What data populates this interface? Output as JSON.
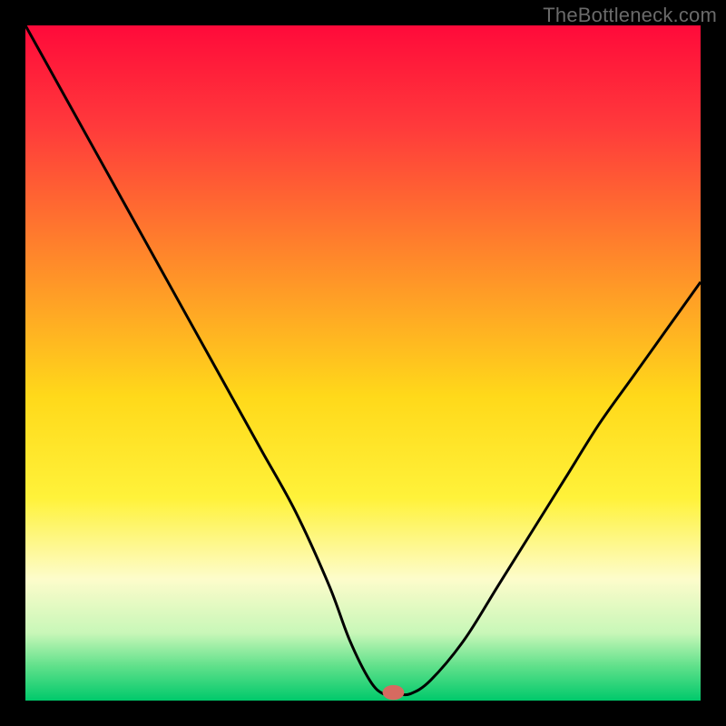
{
  "watermark": "TheBottleneck.com",
  "chart_data": {
    "type": "line",
    "title": "",
    "xlabel": "",
    "ylabel": "",
    "xlim": [
      0,
      100
    ],
    "ylim": [
      0,
      100
    ],
    "background_gradient": {
      "stops": [
        {
          "offset": 0.0,
          "color": "#ff0a3a"
        },
        {
          "offset": 0.15,
          "color": "#ff3a3b"
        },
        {
          "offset": 0.35,
          "color": "#ff8a2a"
        },
        {
          "offset": 0.55,
          "color": "#ffd91a"
        },
        {
          "offset": 0.7,
          "color": "#fff23a"
        },
        {
          "offset": 0.82,
          "color": "#fdfccb"
        },
        {
          "offset": 0.9,
          "color": "#c8f7b8"
        },
        {
          "offset": 0.95,
          "color": "#5ee08a"
        },
        {
          "offset": 1.0,
          "color": "#00c96b"
        }
      ]
    },
    "series": [
      {
        "name": "bottleneck-curve",
        "color": "#000000",
        "x": [
          0,
          5,
          10,
          15,
          20,
          25,
          30,
          35,
          40,
          45,
          48,
          51,
          53,
          55,
          57,
          60,
          65,
          70,
          75,
          80,
          85,
          90,
          95,
          100
        ],
        "y": [
          100,
          91,
          82,
          73,
          64,
          55,
          46,
          37,
          28,
          17,
          9,
          3,
          1,
          1,
          1,
          3,
          9,
          17,
          25,
          33,
          41,
          48,
          55,
          62
        ]
      }
    ],
    "marker": {
      "name": "optimal-point",
      "x": 54.5,
      "y": 1.2,
      "rx": 1.6,
      "ry": 1.1,
      "color": "#d66a60"
    }
  }
}
